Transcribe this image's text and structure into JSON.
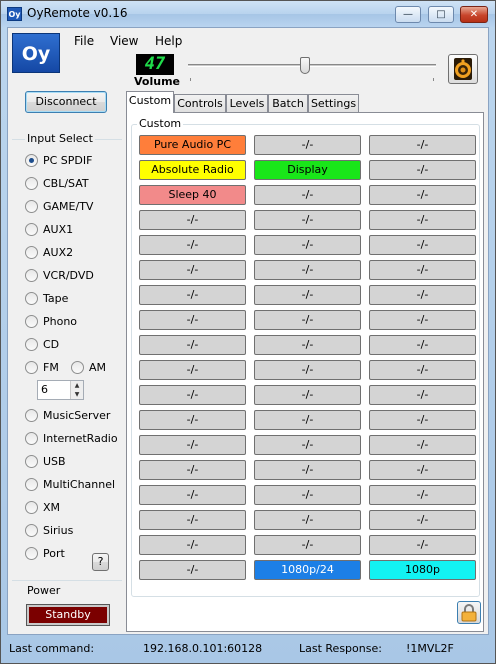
{
  "window": {
    "title": "OyRemote v0.16",
    "icon_text": "Oy",
    "minimize": "—",
    "maximize": "□",
    "close": "✕"
  },
  "logo": "Oy",
  "menu": [
    "File",
    "View",
    "Help"
  ],
  "volume": {
    "value": "47",
    "label": "Volume",
    "level": 0.47
  },
  "disconnect_label": "Disconnect",
  "input_select": {
    "title": "Input Select",
    "selected": "PC SPDIF",
    "items": [
      "PC SPDIF",
      "CBL/SAT",
      "GAME/TV",
      "AUX1",
      "AUX2",
      "VCR/DVD",
      "Tape",
      "Phono",
      "CD",
      "FM",
      "AM",
      "MusicServer",
      "InternetRadio",
      "USB",
      "MultiChannel",
      "XM",
      "Sirius",
      "Port"
    ],
    "preset_value": "6",
    "help_label": "?"
  },
  "power": {
    "title": "Power",
    "standby_label": "Standby"
  },
  "tabs": [
    "Custom",
    "Controls",
    "Levels",
    "Batch",
    "Settings"
  ],
  "custom": {
    "group_title": "Custom",
    "colors": {
      "orange": "#ff7e3a",
      "yellow": "#ffff00",
      "green": "#19e619",
      "pink": "#f28a8a",
      "blue": "#1c7fe6",
      "cyan": "#12f2f2",
      "gray": "#d4d4d4"
    },
    "rows": [
      [
        {
          "label": "Pure Audio PC",
          "color": "orange"
        },
        {
          "label": "-/-",
          "color": "gray"
        },
        {
          "label": "-/-",
          "color": "gray"
        }
      ],
      [
        {
          "label": "Absolute Radio",
          "color": "yellow"
        },
        {
          "label": "Display",
          "color": "green"
        },
        {
          "label": "-/-",
          "color": "gray"
        }
      ],
      [
        {
          "label": "Sleep 40",
          "color": "pink"
        },
        {
          "label": "-/-",
          "color": "gray"
        },
        {
          "label": "-/-",
          "color": "gray"
        }
      ],
      [
        {
          "label": "-/-",
          "color": "gray"
        },
        {
          "label": "-/-",
          "color": "gray"
        },
        {
          "label": "-/-",
          "color": "gray"
        }
      ],
      [
        {
          "label": "-/-",
          "color": "gray"
        },
        {
          "label": "-/-",
          "color": "gray"
        },
        {
          "label": "-/-",
          "color": "gray"
        }
      ],
      [
        {
          "label": "-/-",
          "color": "gray"
        },
        {
          "label": "-/-",
          "color": "gray"
        },
        {
          "label": "-/-",
          "color": "gray"
        }
      ],
      [
        {
          "label": "-/-",
          "color": "gray"
        },
        {
          "label": "-/-",
          "color": "gray"
        },
        {
          "label": "-/-",
          "color": "gray"
        }
      ],
      [
        {
          "label": "-/-",
          "color": "gray"
        },
        {
          "label": "-/-",
          "color": "gray"
        },
        {
          "label": "-/-",
          "color": "gray"
        }
      ],
      [
        {
          "label": "-/-",
          "color": "gray"
        },
        {
          "label": "-/-",
          "color": "gray"
        },
        {
          "label": "-/-",
          "color": "gray"
        }
      ],
      [
        {
          "label": "-/-",
          "color": "gray"
        },
        {
          "label": "-/-",
          "color": "gray"
        },
        {
          "label": "-/-",
          "color": "gray"
        }
      ],
      [
        {
          "label": "-/-",
          "color": "gray"
        },
        {
          "label": "-/-",
          "color": "gray"
        },
        {
          "label": "-/-",
          "color": "gray"
        }
      ],
      [
        {
          "label": "-/-",
          "color": "gray"
        },
        {
          "label": "-/-",
          "color": "gray"
        },
        {
          "label": "-/-",
          "color": "gray"
        }
      ],
      [
        {
          "label": "-/-",
          "color": "gray"
        },
        {
          "label": "-/-",
          "color": "gray"
        },
        {
          "label": "-/-",
          "color": "gray"
        }
      ],
      [
        {
          "label": "-/-",
          "color": "gray"
        },
        {
          "label": "-/-",
          "color": "gray"
        },
        {
          "label": "-/-",
          "color": "gray"
        }
      ],
      [
        {
          "label": "-/-",
          "color": "gray"
        },
        {
          "label": "-/-",
          "color": "gray"
        },
        {
          "label": "-/-",
          "color": "gray"
        }
      ],
      [
        {
          "label": "-/-",
          "color": "gray"
        },
        {
          "label": "-/-",
          "color": "gray"
        },
        {
          "label": "-/-",
          "color": "gray"
        }
      ],
      [
        {
          "label": "-/-",
          "color": "gray"
        },
        {
          "label": "-/-",
          "color": "gray"
        },
        {
          "label": "-/-",
          "color": "gray"
        }
      ],
      [
        {
          "label": "-/-",
          "color": "gray"
        },
        {
          "label": "1080p/24",
          "color": "blue"
        },
        {
          "label": "1080p",
          "color": "cyan"
        }
      ]
    ]
  },
  "status": {
    "last_command_label": "Last command:",
    "last_command_value": "192.168.0.101:60128",
    "last_response_label": "Last Response:",
    "last_response_value": "!1MVL2F"
  },
  "icons": {
    "speaker": "speaker-icon",
    "lock": "padlock-icon"
  }
}
